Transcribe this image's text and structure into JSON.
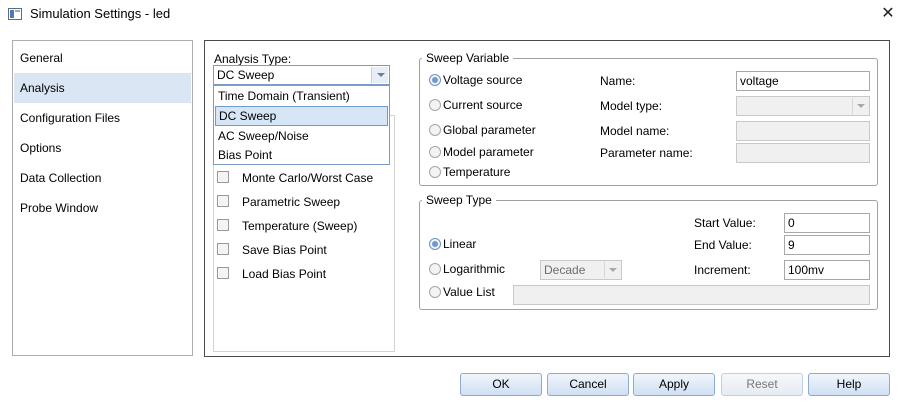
{
  "window": {
    "title": "Simulation Settings - led",
    "icon": "window-app-icon",
    "close_icon": "close-icon",
    "close_glyph": "✕"
  },
  "nav": {
    "items": [
      {
        "label": "General",
        "selected": false
      },
      {
        "label": "Analysis",
        "selected": true
      },
      {
        "label": "Configuration Files",
        "selected": false
      },
      {
        "label": "Options",
        "selected": false
      },
      {
        "label": "Data Collection",
        "selected": false
      },
      {
        "label": "Probe Window",
        "selected": false
      }
    ]
  },
  "analysis": {
    "label": "Analysis Type:",
    "selected": "DC Sweep",
    "options": [
      {
        "label": "Time Domain (Transient)",
        "highlighted": false
      },
      {
        "label": "DC Sweep",
        "highlighted": true
      },
      {
        "label": "AC Sweep/Noise",
        "highlighted": false
      },
      {
        "label": "Bias Point",
        "highlighted": false
      }
    ]
  },
  "options_checkboxes": [
    {
      "label": "Monte Carlo/Worst Case",
      "checked": false
    },
    {
      "label": "Parametric Sweep",
      "checked": false
    },
    {
      "label": "Temperature (Sweep)",
      "checked": false
    },
    {
      "label": "Save Bias Point",
      "checked": false
    },
    {
      "label": "Load Bias Point",
      "checked": false
    }
  ],
  "sweep_variable": {
    "title": "Sweep Variable",
    "radios": [
      {
        "label": "Voltage source",
        "checked": true
      },
      {
        "label": "Current source",
        "checked": false
      },
      {
        "label": "Global parameter",
        "checked": false
      },
      {
        "label": "Model parameter",
        "checked": false
      },
      {
        "label": "Temperature",
        "checked": false
      }
    ],
    "name_label": "Name:",
    "name_value": "voltage",
    "model_type_label": "Model type:",
    "model_type_value": "",
    "model_name_label": "Model name:",
    "model_name_value": "",
    "parameter_name_label": "Parameter name:",
    "parameter_name_value": ""
  },
  "sweep_type": {
    "title": "Sweep Type",
    "radios": [
      {
        "label": "Linear",
        "checked": true
      },
      {
        "label": "Logarithmic",
        "checked": false
      },
      {
        "label": "Value List",
        "checked": false
      }
    ],
    "log_mode_value": "Decade",
    "start_label": "Start Value:",
    "start_value": "0",
    "end_label": "End Value:",
    "end_value": "9",
    "increment_label": "Increment:",
    "increment_value": "100mv",
    "value_list_value": ""
  },
  "footer": {
    "ok": "OK",
    "cancel": "Cancel",
    "apply": "Apply",
    "reset": "Reset",
    "help": "Help"
  },
  "colors": {
    "selection": "#dbe6f4",
    "button_border": "#8faad1",
    "radio_dot": "#6d9ad6"
  }
}
